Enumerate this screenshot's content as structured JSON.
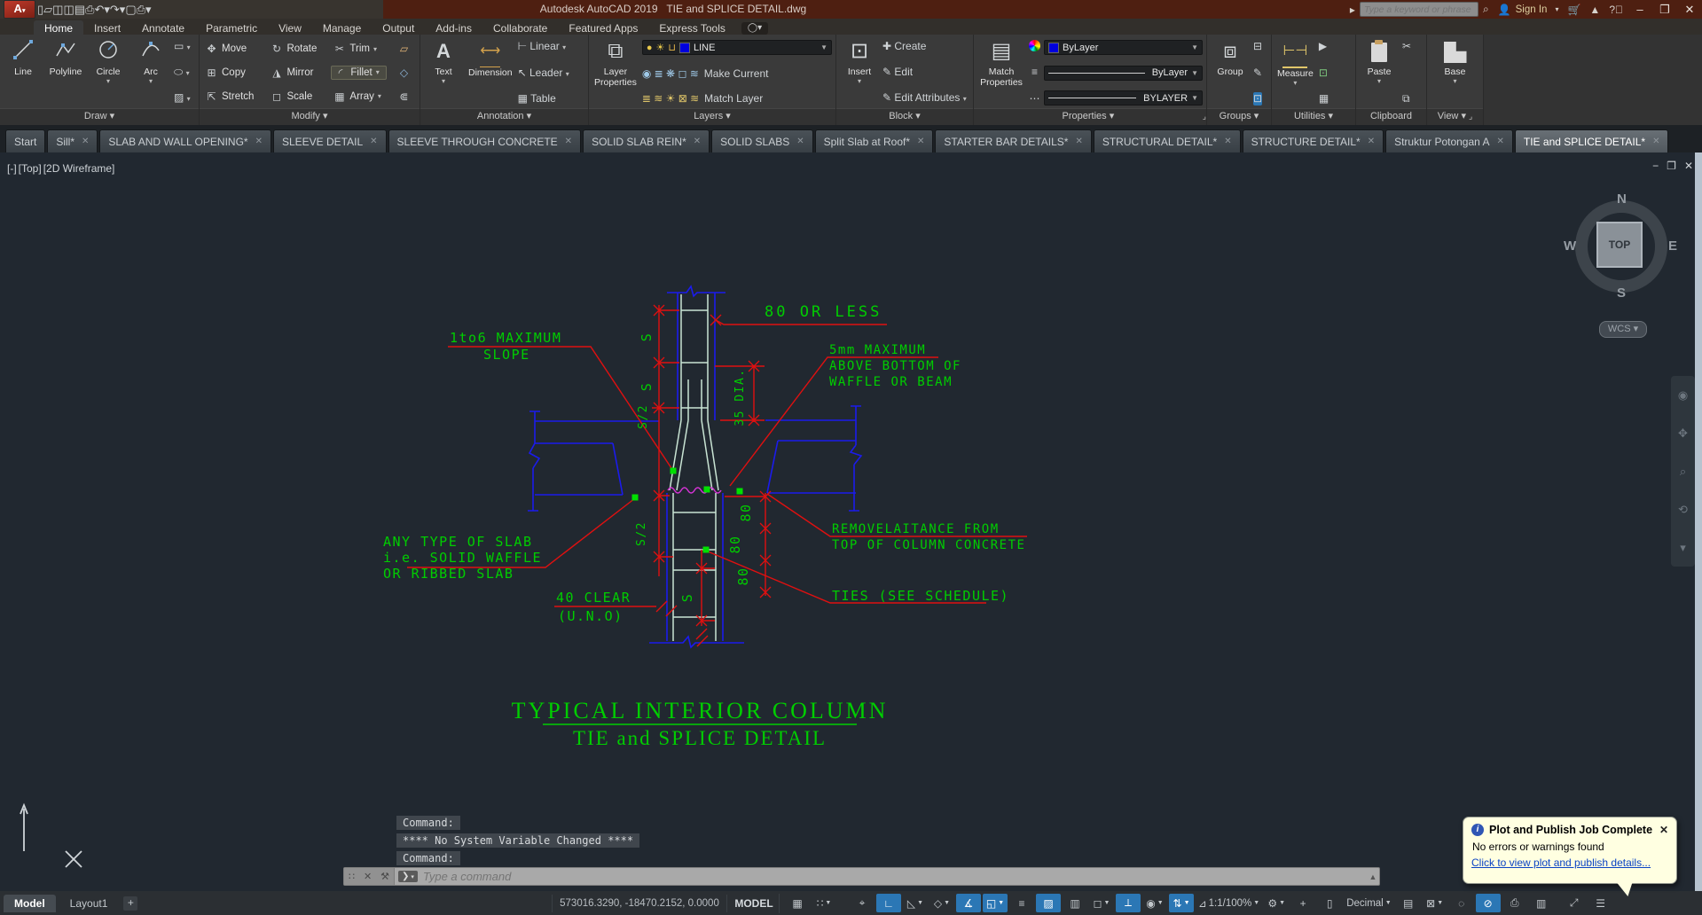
{
  "colors": {
    "cad_green": "#00cd00",
    "cad_red": "#e01010",
    "cad_blue": "#1b1bec",
    "cad_rebar": "#c9e4d4",
    "cad_magenta": "#d633d6",
    "accent_blue": "#2b77b5",
    "titlebar": "#4e1f11",
    "notification_bg": "#ffffe1",
    "link_blue": "#0a43c4"
  },
  "title_bar": {
    "title": "Autodesk AutoCAD 2019   TIE and SPLICE DETAIL.dwg",
    "search_placeholder": "Type a keyword or phrase",
    "sign_in_label": "Sign In"
  },
  "qat_icons": [
    {
      "name": "new-file-icon",
      "glyph": "▯"
    },
    {
      "name": "open-folder-icon",
      "glyph": "▱"
    },
    {
      "name": "save-icon",
      "glyph": "◫"
    },
    {
      "name": "save-as-icon",
      "glyph": "◫"
    },
    {
      "name": "plot-icon",
      "glyph": "▤"
    },
    {
      "name": "print-icon",
      "glyph": "⎙"
    },
    {
      "name": "undo-icon",
      "glyph": "↶"
    },
    {
      "name": "undo-caret-icon",
      "glyph": "▾"
    },
    {
      "name": "redo-icon",
      "glyph": "↷"
    },
    {
      "name": "redo-caret-icon",
      "glyph": "▾"
    },
    {
      "name": "plot-preview-icon",
      "glyph": "▢"
    },
    {
      "name": "batch-plot-icon",
      "glyph": "⎙"
    },
    {
      "name": "qat-customize-icon",
      "glyph": "▾"
    }
  ],
  "ribbon": {
    "tabs": [
      {
        "label": "Home",
        "active": true
      },
      {
        "label": "Insert"
      },
      {
        "label": "Annotate"
      },
      {
        "label": "Parametric"
      },
      {
        "label": "View"
      },
      {
        "label": "Manage"
      },
      {
        "label": "Output"
      },
      {
        "label": "Add-ins"
      },
      {
        "label": "Collaborate"
      },
      {
        "label": "Featured Apps"
      },
      {
        "label": "Express Tools"
      }
    ],
    "draw": {
      "label": "Draw",
      "line": "Line",
      "polyline": "Polyline",
      "circle": "Circle",
      "arc": "Arc"
    },
    "modify": {
      "label": "Modify",
      "move": "Move",
      "rotate": "Rotate",
      "trim": "Trim",
      "copy": "Copy",
      "mirror": "Mirror",
      "fillet": "Fillet",
      "stretch": "Stretch",
      "scale": "Scale",
      "array": "Array"
    },
    "annotation": {
      "label": "Annotation",
      "text": "Text",
      "dimension": "Dimension",
      "linear": "Linear",
      "leader": "Leader",
      "table": "Table"
    },
    "layers": {
      "label": "Layers",
      "layer_properties_1": "Layer",
      "layer_properties_2": "Properties",
      "current_layer": "LINE",
      "make_current": "Make Current",
      "match_layer": "Match Layer"
    },
    "block": {
      "label": "Block",
      "insert": "Insert",
      "create": "Create",
      "edit": "Edit",
      "edit_attributes": "Edit Attributes"
    },
    "properties": {
      "label": "Properties",
      "match_1": "Match",
      "match_2": "Properties",
      "color": "ByLayer",
      "linetype": "ByLayer",
      "lineweight": "BYLAYER"
    },
    "groups": {
      "label": "Groups",
      "group": "Group"
    },
    "utilities": {
      "label": "Utilities",
      "measure": "Measure"
    },
    "clipboard": {
      "label": "Clipboard",
      "paste": "Paste"
    },
    "view": {
      "label": "View",
      "base": "Base"
    }
  },
  "file_tabs": [
    {
      "label": "Start",
      "closable": false,
      "active": false
    },
    {
      "label": "Sill*",
      "closable": true,
      "active": false
    },
    {
      "label": "SLAB AND WALL OPENING*",
      "closable": true,
      "active": false
    },
    {
      "label": "SLEEVE DETAIL",
      "closable": true,
      "active": false
    },
    {
      "label": "SLEEVE THROUGH CONCRETE",
      "closable": true,
      "active": false
    },
    {
      "label": "SOLID SLAB REIN*",
      "closable": true,
      "active": false
    },
    {
      "label": "SOLID SLABS",
      "closable": true,
      "active": false
    },
    {
      "label": "Split Slab at Roof*",
      "closable": true,
      "active": false
    },
    {
      "label": "STARTER BAR DETAILS*",
      "closable": true,
      "active": false
    },
    {
      "label": "STRUCTURAL DETAIL*",
      "closable": true,
      "active": false
    },
    {
      "label": "STRUCTURE DETAIL*",
      "closable": true,
      "active": false
    },
    {
      "label": "Struktur Potongan A",
      "closable": true,
      "active": false
    },
    {
      "label": "TIE and SPLICE DETAIL*",
      "closable": true,
      "active": true
    }
  ],
  "viewport": {
    "ctl_minus": "[-]",
    "ctl_view": "[Top]",
    "ctl_style": "[2D Wireframe]",
    "viewcube": {
      "n": "N",
      "s": "S",
      "e": "E",
      "w": "W",
      "top": "TOP"
    },
    "wcs": "WCS"
  },
  "drawing": {
    "labels": {
      "slope_1": "1to6 MAXIMUM",
      "slope_2": "SLOPE",
      "or_less": "80 OR LESS",
      "mm_1": "5mm MAXIMUM",
      "mm_2": "ABOVE BOTTOM OF",
      "mm_3": "WAFFLE OR BEAM",
      "slab_1": "ANY TYPE OF SLAB",
      "slab_2": "i.e. SOLID WAFFLE",
      "slab_3": "OR RIBBED SLAB",
      "clear_1": "40 CLEAR",
      "clear_2": "(U.N.O)",
      "laitance_1": "REMOVELAITANCE FROM",
      "laitance_2": "TOP OF COLUMN CONCRETE",
      "ties": "TIES (SEE SCHEDULE)",
      "dim_s_1": "S",
      "dim_s_2": "S",
      "dim_s_half_1": "S/2",
      "dim_s_half_2": "S/2",
      "dim_dia": "35 DIA.",
      "dim_80_1": "80",
      "dim_80_2": "80",
      "dim_80_3": "80",
      "dim_s_3": "S"
    },
    "title_line1": "TYPICAL INTERIOR COLUMN",
    "title_line2": "TIE and SPLICE DETAIL"
  },
  "command_line": {
    "history": [
      "Command:",
      "**** No System Variable Changed ****",
      "Command:"
    ],
    "placeholder": "Type a command"
  },
  "status_bar": {
    "model_tab": "Model",
    "layout_tab": "Layout1",
    "add_layout": "+",
    "coordinates": "573016.3290, -18470.2152, 0.0000",
    "space_badge": "MODEL",
    "annotation_scale": "1:1/100%",
    "units": "Decimal",
    "toggles": [
      {
        "name": "grid",
        "on": false
      },
      {
        "name": "snap",
        "on": false,
        "caret": true
      },
      {
        "name": "dynamic-input",
        "on": false,
        "gap": 14
      },
      {
        "name": "ortho",
        "on": true
      },
      {
        "name": "polar-tracking",
        "on": false,
        "caret": true
      },
      {
        "name": "isodraft",
        "on": false,
        "caret": true
      },
      {
        "name": "object-snap-tracking",
        "on": true
      },
      {
        "name": "object-snap",
        "on": true,
        "caret": true
      },
      {
        "name": "lineweight",
        "on": false
      },
      {
        "name": "transparency",
        "on": true
      },
      {
        "name": "selection-cycling",
        "on": false
      },
      {
        "name": "3d-object-snap",
        "on": false,
        "caret": true
      },
      {
        "name": "dynamic-ucs",
        "on": true
      },
      {
        "name": "annotation-visibility",
        "on": false,
        "caret": true
      },
      {
        "name": "autoscale",
        "on": true,
        "caret": true
      },
      {
        "name": "annotation-scale",
        "on": false,
        "label": "1:1/100%",
        "caret": true
      },
      {
        "name": "workspace-gear",
        "on": false,
        "caret": true
      },
      {
        "name": "plus",
        "on": false
      },
      {
        "name": "annotation-monitor",
        "on": false
      },
      {
        "name": "units",
        "on": false,
        "label": "Decimal",
        "caret": true
      },
      {
        "name": "quick-properties",
        "on": false
      },
      {
        "name": "lock-ui",
        "on": false,
        "caret": true
      },
      {
        "name": "isolate-objects",
        "on": false
      },
      {
        "name": "graphics-performance",
        "on": true
      },
      {
        "name": "plot-job",
        "on": false
      },
      {
        "name": "import-notify",
        "on": false
      },
      {
        "name": "clean-screen",
        "on": false,
        "gap": 8
      },
      {
        "name": "customize-menu",
        "on": false
      }
    ]
  },
  "notification": {
    "title": "Plot and Publish Job Complete",
    "body": "No errors or warnings found",
    "link": "Click to view plot and publish details..."
  }
}
